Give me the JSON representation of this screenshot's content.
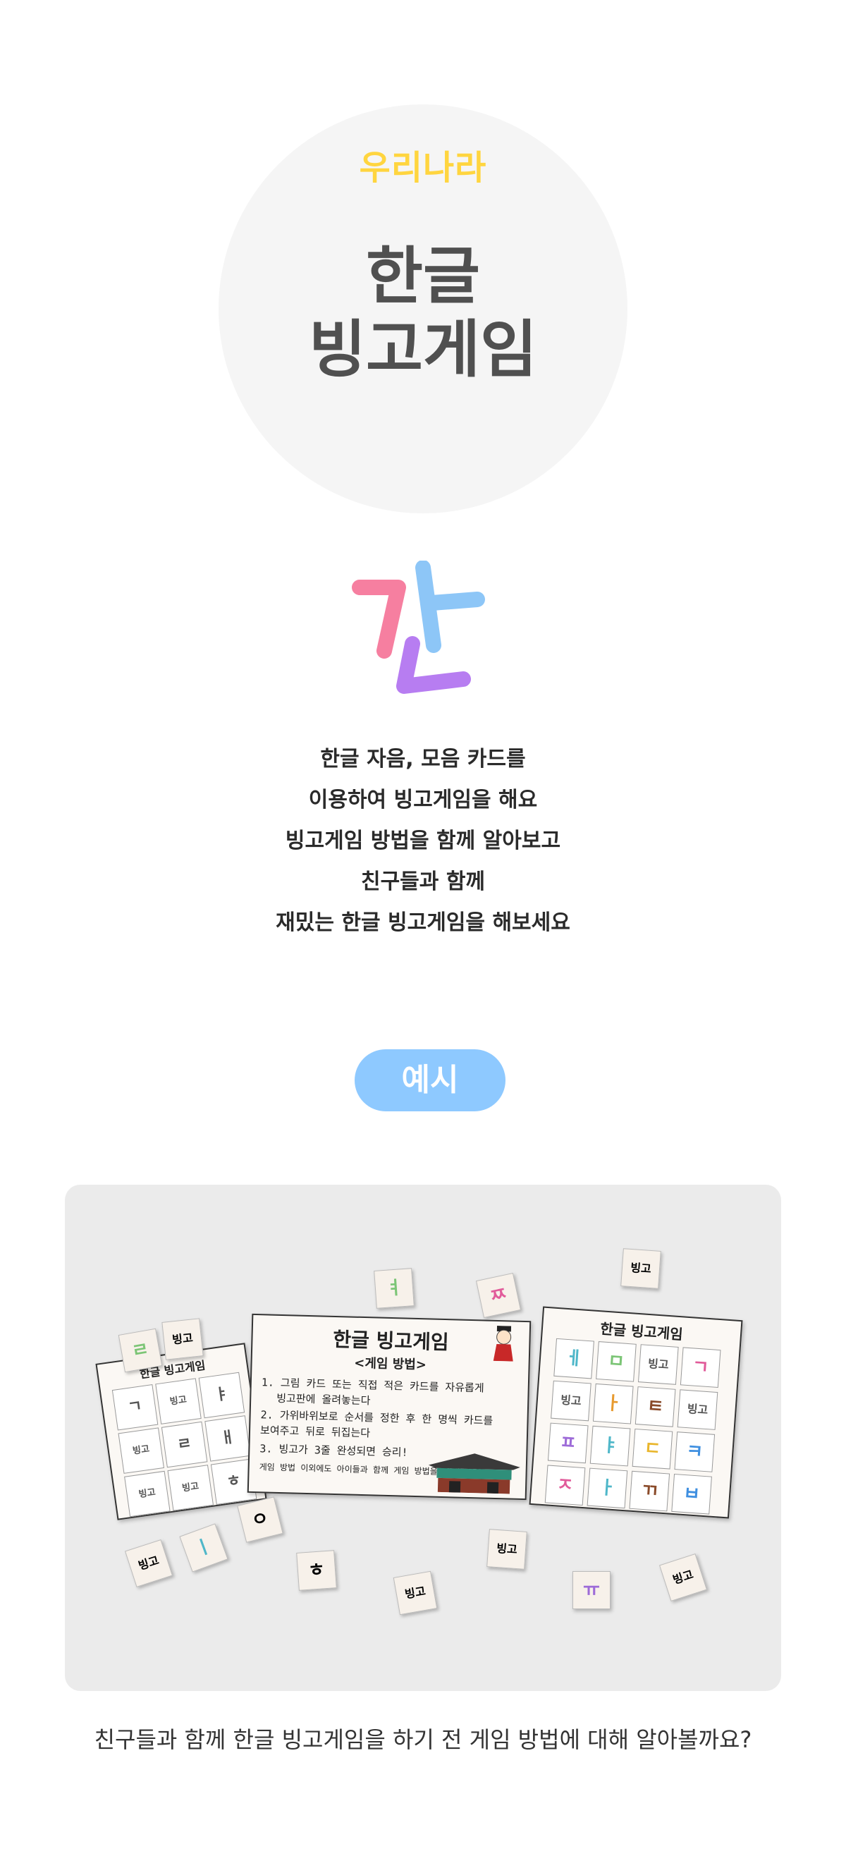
{
  "hero": {
    "subtitle": "우리나라",
    "title_line1": "한글",
    "title_line2": "빙고게임"
  },
  "logo": {
    "icon": "hangul-gan-logo-icon",
    "colors": [
      "#f67fa0",
      "#8dc6f7",
      "#b77df1"
    ]
  },
  "description": [
    "한글 자음, 모음 카드를",
    "이용하여 빙고게임을 해요",
    "빙고게임 방법을 함께 알아보고",
    "친구들과 함께",
    "재밌는 한글 빙고게임을 해보세요"
  ],
  "example_label": "예시",
  "photo": {
    "left_board": {
      "title": "한글 빙고게임",
      "cells": [
        "ㄱ",
        "빙고",
        "ㅑ",
        "빙고",
        "ㄹ",
        "ㅐ",
        "빙고",
        "빙고",
        "ㅎ"
      ]
    },
    "center_board": {
      "title": "한글 빙고게임",
      "subtitle": "<게임 방법>",
      "rules": [
        "1. 그림 카드 또는 직접 적은 카드를 자유롭게",
        "빙고판에 올려놓는다",
        "2. 가위바위보로 순서를 정한 후 한 명씩 카드를",
        "보여주고 뒤로 뒤집는다",
        "3. 빙고가 3줄 완성되면 승리!",
        "게임 방법 이외에도 아이들과 함께 게임 방법을 정해보세요!"
      ]
    },
    "right_board": {
      "title": "한글 빙고게임",
      "cells": [
        "ㅔ",
        "ㅁ",
        "빙고",
        "ㄱ",
        "빙고",
        "ㅏ",
        "ㅌ",
        "빙고",
        "ㅍ",
        "ㅑ",
        "ㄷ",
        "ㅋ",
        "ㅈ",
        "ㅏ",
        "ㄲ",
        "ㅂ"
      ]
    },
    "loose_cards": [
      {
        "text": "ㄹ",
        "color": "#7cc576"
      },
      {
        "text": "빙고",
        "color": "#222222"
      },
      {
        "text": "ㅕ",
        "color": "#7cc576"
      },
      {
        "text": "ㅉ",
        "color": "#e15b9a"
      },
      {
        "text": "빙고",
        "color": "#222222"
      },
      {
        "text": "ㅇ",
        "color": "#222222"
      },
      {
        "text": "빙고",
        "color": "#222222"
      },
      {
        "text": "ㅣ",
        "color": "#4fb7c9"
      },
      {
        "text": "ㅎ",
        "color": "#222222"
      },
      {
        "text": "빙고",
        "color": "#222222"
      },
      {
        "text": "빙고",
        "color": "#222222"
      },
      {
        "text": "ㅠ",
        "color": "#9d6bd8"
      },
      {
        "text": "빙고",
        "color": "#222222"
      }
    ]
  },
  "caption": "친구들과 함께 한글 빙고게임을 하기 전 게임 방법에 대해 알아볼까요?"
}
